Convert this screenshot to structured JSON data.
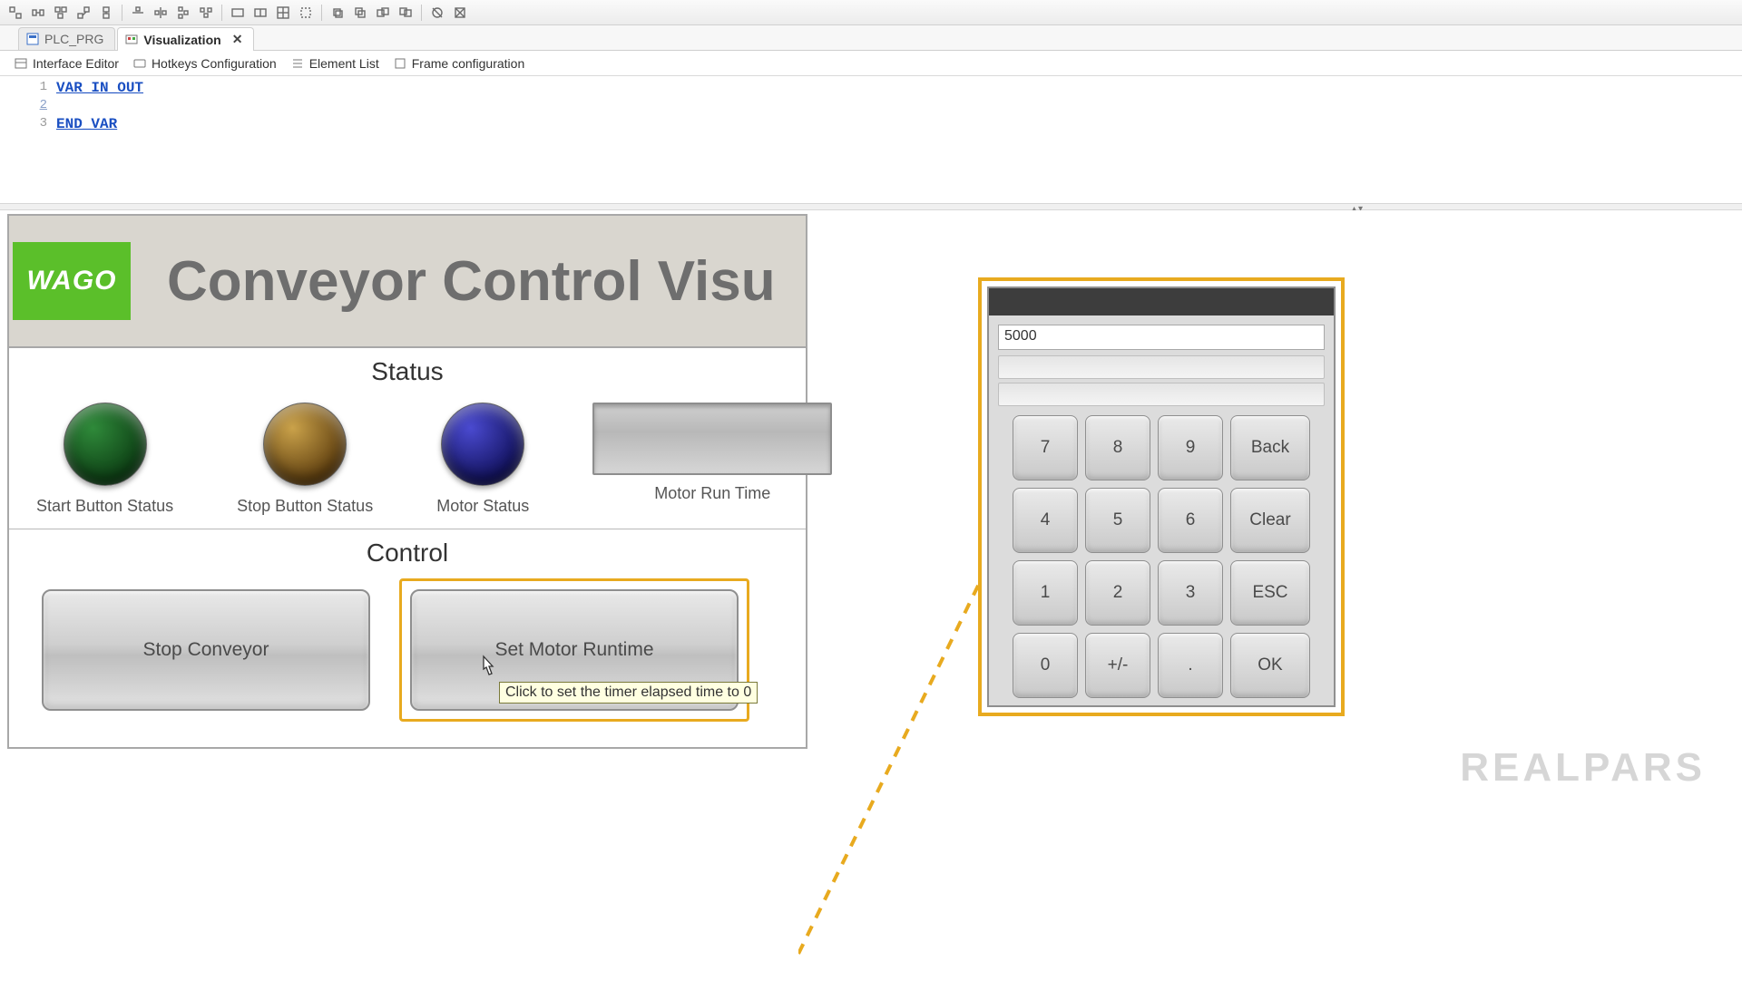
{
  "tabs": {
    "plc": "PLC_PRG",
    "visu": "Visualization"
  },
  "subtabs": {
    "interface": "Interface Editor",
    "hotkeys": "Hotkeys Configuration",
    "elements": "Element List",
    "frame": "Frame configuration"
  },
  "code": {
    "l1_num": "1",
    "l1": "VAR_IN_OUT",
    "l2_num": "2",
    "l3_num": "3",
    "l3": "END_VAR"
  },
  "visu": {
    "logo": "WAGO",
    "title": "Conveyor Control Visu",
    "status_head": "Status",
    "lamp_start": "Start Button Status",
    "lamp_stop": "Stop Button Status",
    "lamp_motor": "Motor Status",
    "bar_label": "Motor Run Time",
    "control_head": "Control",
    "btn_stop": "Stop Conveyor",
    "btn_setrt": "Set Motor Runtime",
    "tooltip": "Click to set the timer elapsed time to 0"
  },
  "numpad": {
    "value": "5000",
    "k7": "7",
    "k8": "8",
    "k9": "9",
    "back": "Back",
    "k4": "4",
    "k5": "5",
    "k6": "6",
    "clear": "Clear",
    "k1": "1",
    "k2": "2",
    "k3": "3",
    "esc": "ESC",
    "k0": "0",
    "pm": "+/-",
    "dot": ".",
    "ok": "OK"
  },
  "watermark": "REALPARS"
}
